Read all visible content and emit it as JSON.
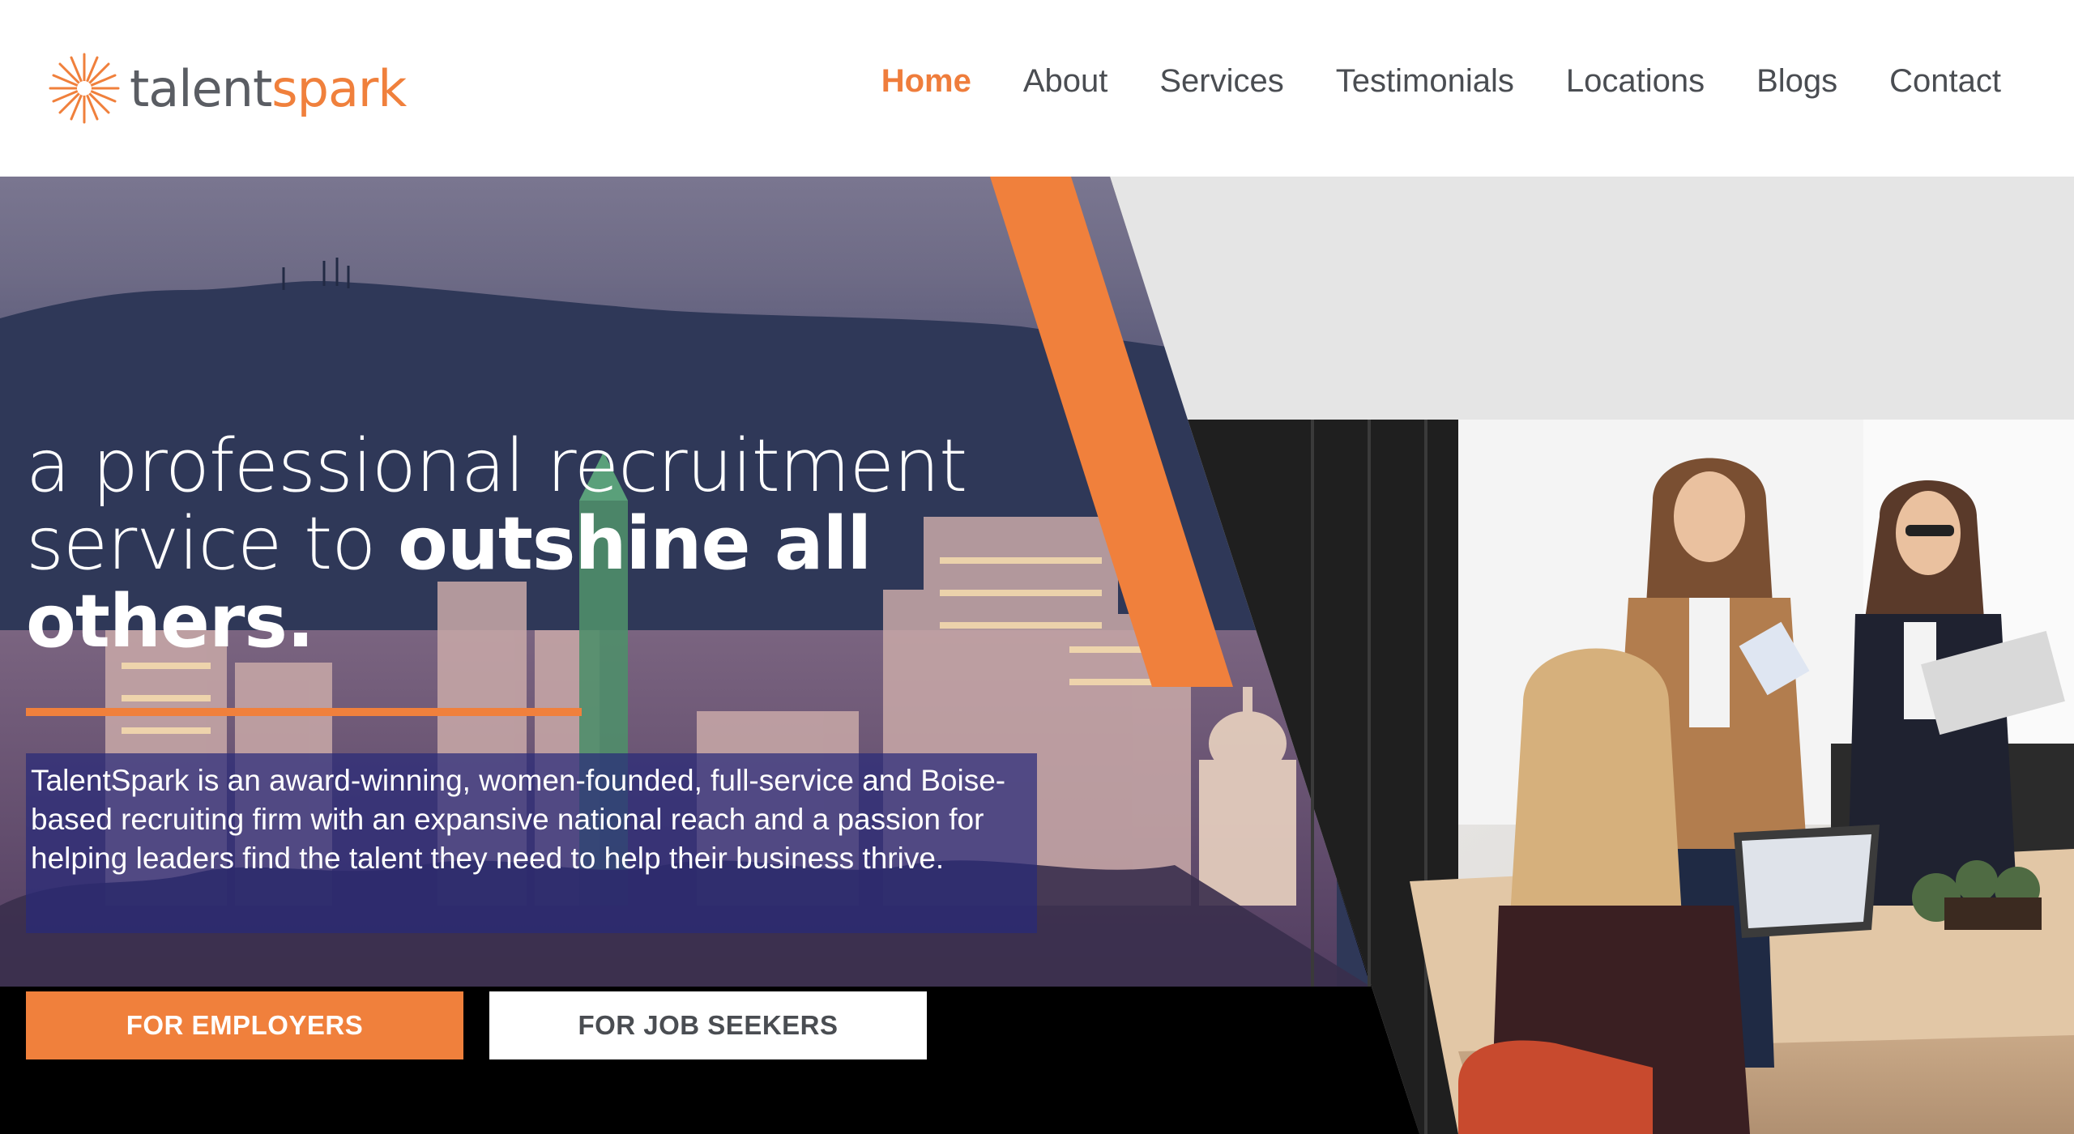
{
  "brand": {
    "name_part1": "talent",
    "name_part2": "spark",
    "logo_icon": "starburst-icon",
    "accent_color": "#f0803c"
  },
  "nav": {
    "items": [
      {
        "label": "Home",
        "active": true
      },
      {
        "label": "About",
        "active": false
      },
      {
        "label": "Services",
        "active": false
      },
      {
        "label": "Testimonials",
        "active": false
      },
      {
        "label": "Locations",
        "active": false
      },
      {
        "label": "Blogs",
        "active": false
      },
      {
        "label": "Contact",
        "active": false
      }
    ]
  },
  "hero": {
    "headline_light_line1": "a professional recruitment",
    "headline_light_line2": "service to ",
    "headline_bold_1": "outshine all",
    "headline_bold_2": "others.",
    "description": "TalentSpark is an award-winning, women-founded, full-service and Boise-based recruiting firm with an expansive national reach and a passion for helping leaders find the talent they need to help their business thrive.",
    "buttons": {
      "employers": "FOR EMPLOYERS",
      "job_seekers": "FOR JOB SEEKERS"
    },
    "background_image": "city-skyline-photo",
    "side_image": "team-meeting-photo"
  }
}
